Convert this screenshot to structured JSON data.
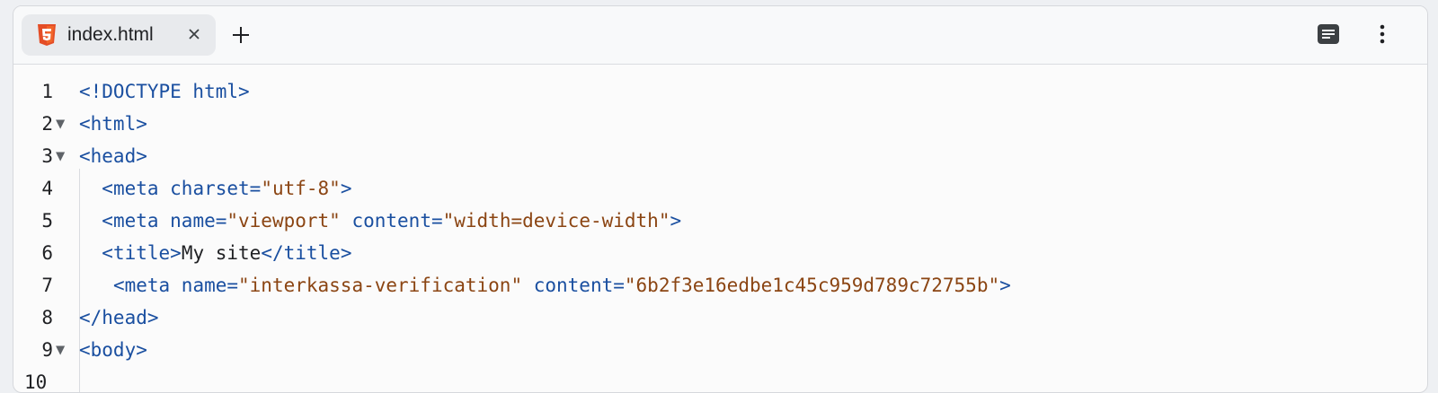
{
  "tab": {
    "title": "index.html",
    "icon": "html5-icon",
    "close_glyph": "×"
  },
  "toolbar": {
    "new_tab_glyph": "+",
    "reader_icon": "reader-mode-icon",
    "menu_glyph": "⋮"
  },
  "colors": {
    "tag": "#1a4fa0",
    "string": "#8b4513",
    "text": "#202124",
    "html5_orange": "#e44d26"
  },
  "editor": {
    "lines": [
      {
        "n": "1",
        "fold": "",
        "indent": "",
        "tokens": [
          [
            "tag",
            "<!DOCTYPE html>"
          ]
        ]
      },
      {
        "n": "2",
        "fold": "▼",
        "indent": "",
        "tokens": [
          [
            "tag",
            "<html>"
          ]
        ]
      },
      {
        "n": "3",
        "fold": "▼",
        "indent": "",
        "tokens": [
          [
            "tag",
            "<head>"
          ]
        ]
      },
      {
        "n": "4",
        "fold": "",
        "indent": "  ",
        "tokens": [
          [
            "tag",
            "<meta "
          ],
          [
            "attr",
            "charset="
          ],
          [
            "str",
            "\"utf-8\""
          ],
          [
            "tag",
            ">"
          ]
        ]
      },
      {
        "n": "5",
        "fold": "",
        "indent": "  ",
        "tokens": [
          [
            "tag",
            "<meta "
          ],
          [
            "attr",
            "name="
          ],
          [
            "str",
            "\"viewport\""
          ],
          [
            "attr",
            " content="
          ],
          [
            "str",
            "\"width=device-width\""
          ],
          [
            "tag",
            ">"
          ]
        ]
      },
      {
        "n": "6",
        "fold": "",
        "indent": "  ",
        "tokens": [
          [
            "tag",
            "<title>"
          ],
          [
            "txt",
            "My site"
          ],
          [
            "tag",
            "</title>"
          ]
        ]
      },
      {
        "n": "7",
        "fold": "",
        "indent": "   ",
        "tokens": [
          [
            "tag",
            "<meta "
          ],
          [
            "attr",
            "name="
          ],
          [
            "str",
            "\"interkassa-verification\""
          ],
          [
            "attr",
            " content="
          ],
          [
            "str",
            "\"6b2f3e16edbe1c45c959d789c72755b\""
          ],
          [
            "tag",
            ">"
          ]
        ]
      },
      {
        "n": "8",
        "fold": "",
        "indent": "",
        "tokens": [
          [
            "tag",
            "</head>"
          ]
        ]
      },
      {
        "n": "9",
        "fold": "▼",
        "indent": "",
        "tokens": [
          [
            "tag",
            "<body>"
          ]
        ]
      },
      {
        "n": "10",
        "fold": "",
        "indent": "",
        "tokens": []
      }
    ]
  }
}
